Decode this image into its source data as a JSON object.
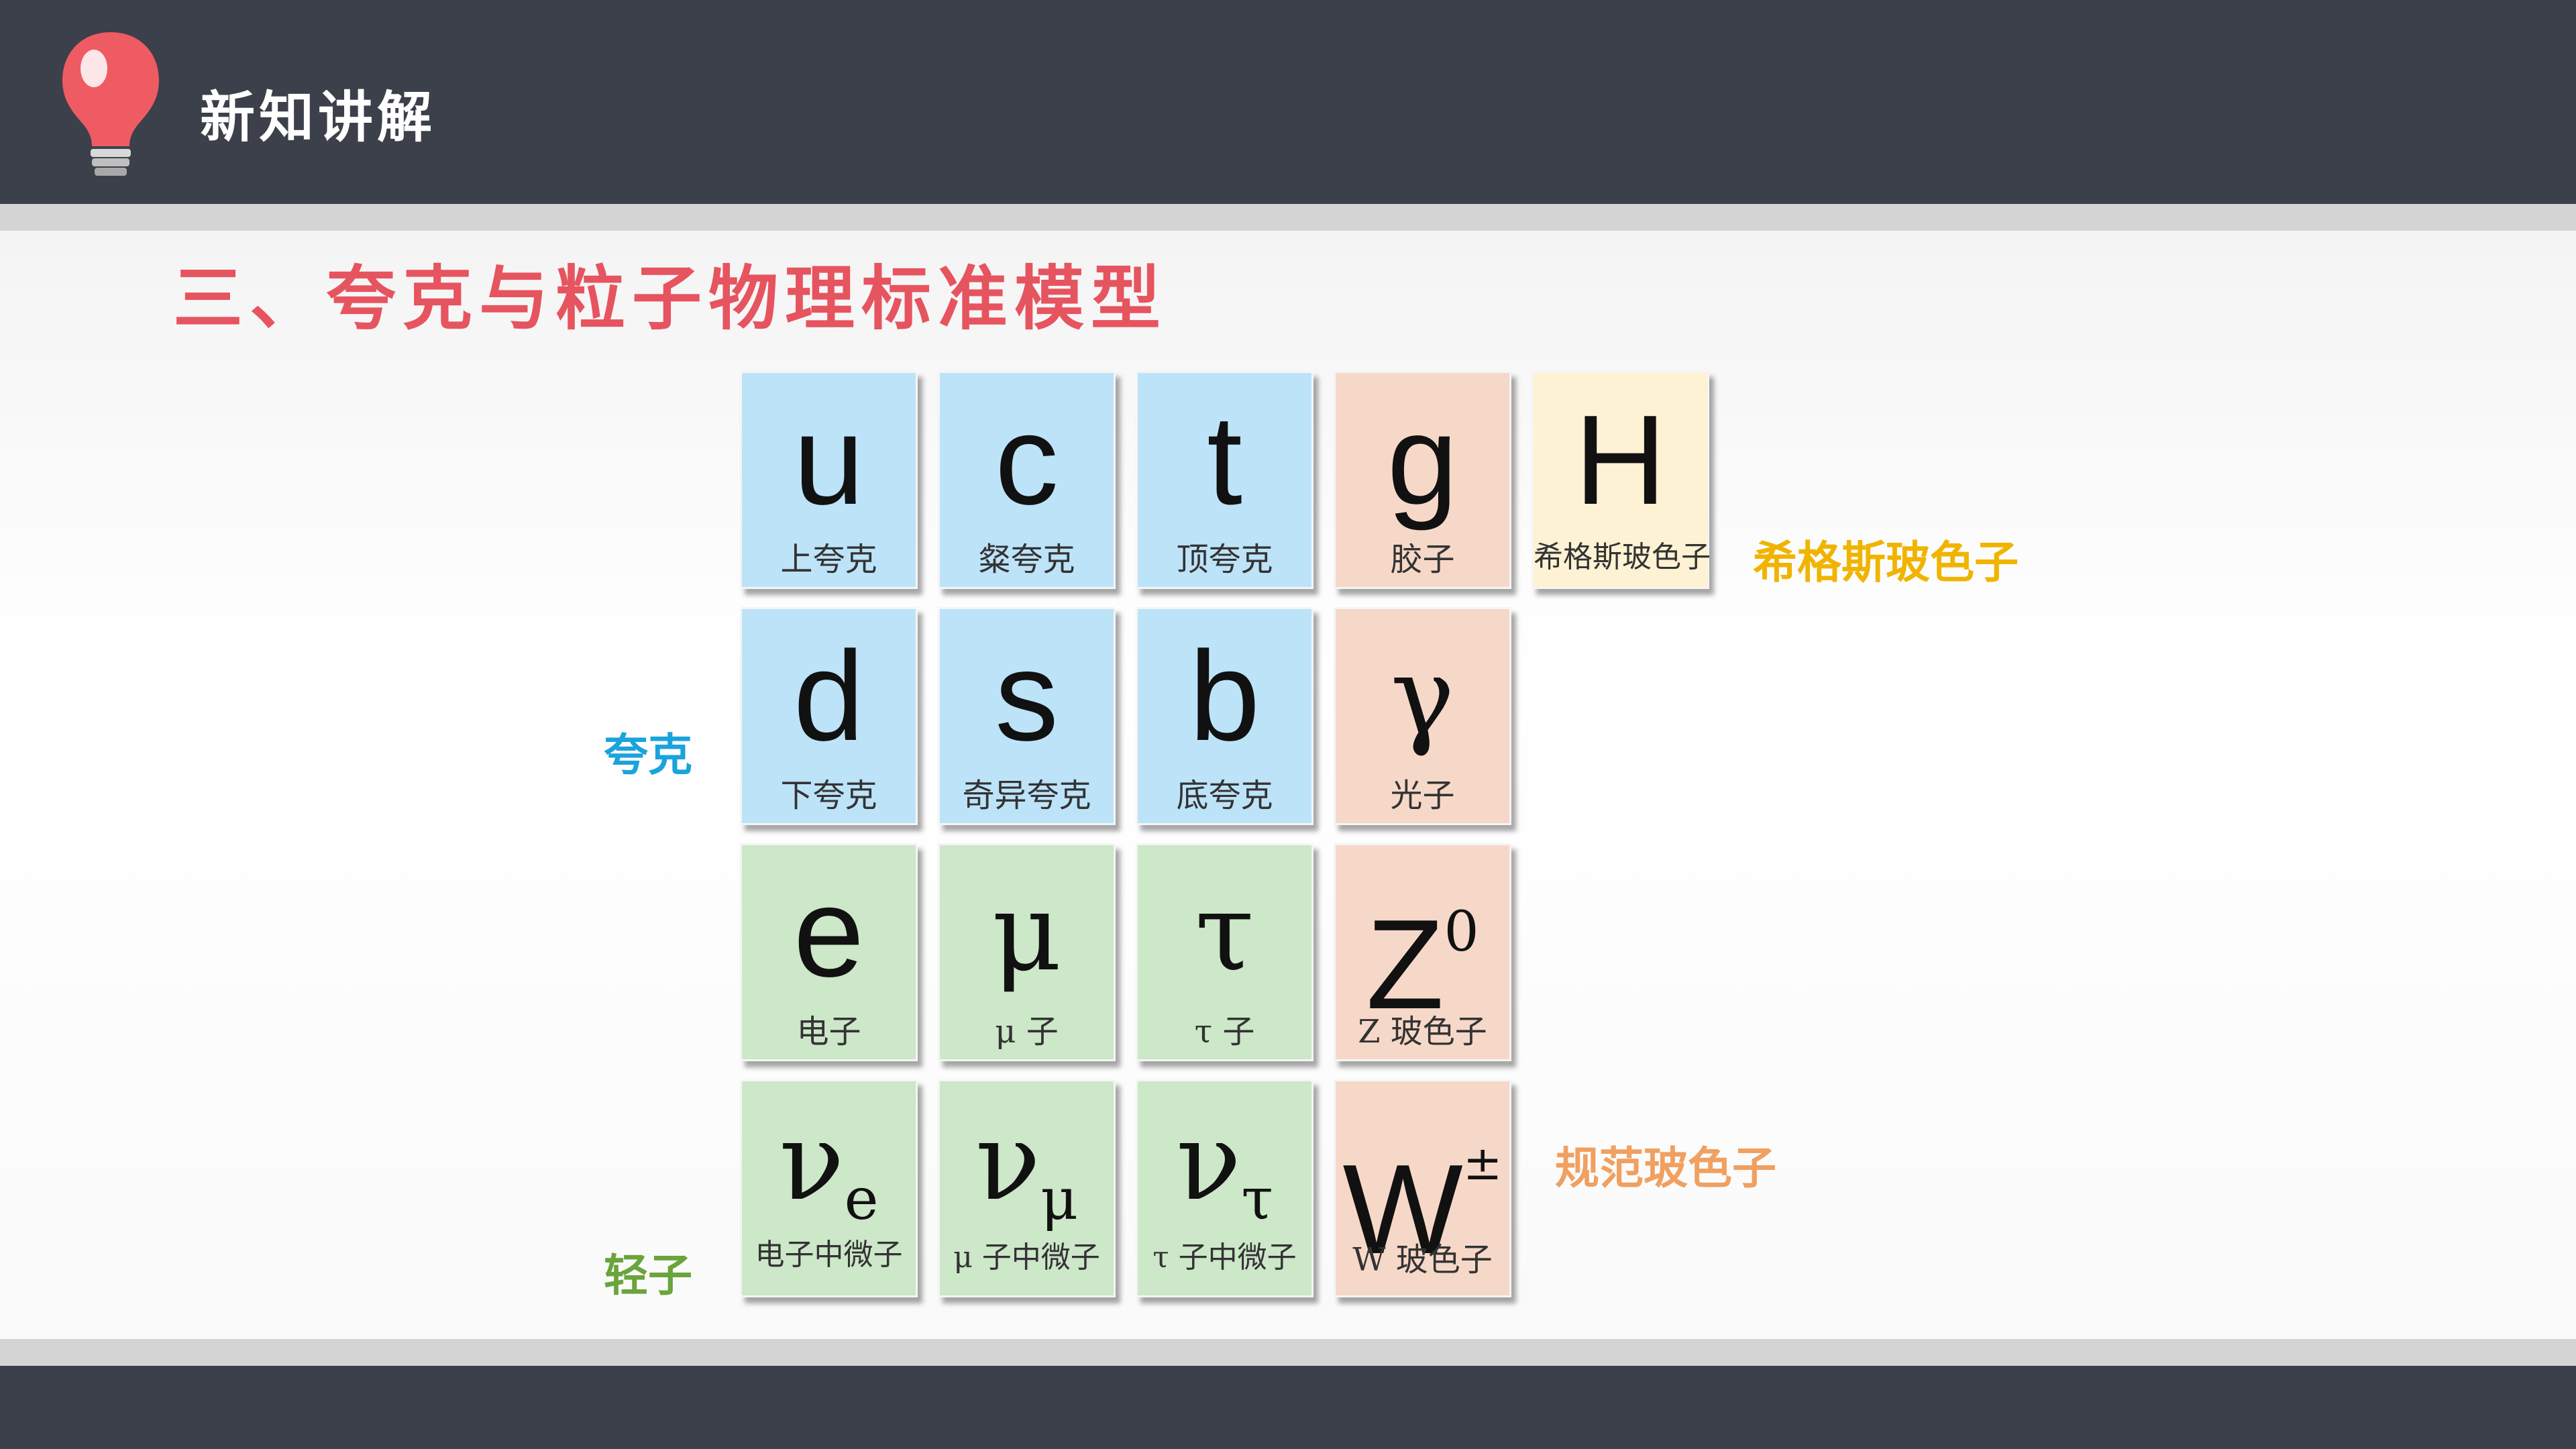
{
  "header": {
    "title": "新知讲解"
  },
  "section": {
    "title": "三、夸克与粒子物理标准模型"
  },
  "colors": {
    "bar": "#3b404a",
    "title_red": "#e6545f",
    "quark_tile": "#bde3f8",
    "lepton_tile": "#cde7c9",
    "gauge_tile": "#f6d8c9",
    "higgs_tile": "#fdf2d3",
    "label_quark": "#1aa3dc",
    "label_lepton": "#6aa43b",
    "label_higgs": "#f0b400",
    "label_gauge": "#f0a060"
  },
  "particles": {
    "u": {
      "symbol": "u",
      "name": "上夸克"
    },
    "c": {
      "symbol": "c",
      "name": "粲夸克"
    },
    "t": {
      "symbol": "t",
      "name": "顶夸克"
    },
    "g": {
      "symbol": "g",
      "name": "胶子"
    },
    "H": {
      "symbol": "H",
      "name": "希格斯玻色子"
    },
    "d": {
      "symbol": "d",
      "name": "下夸克"
    },
    "s": {
      "symbol": "s",
      "name": "奇异夸克"
    },
    "b": {
      "symbol": "b",
      "name": "底夸克"
    },
    "gamma": {
      "symbol": "γ",
      "name": "光子"
    },
    "e": {
      "symbol": "e",
      "name": "电子"
    },
    "mu": {
      "symbol": "μ",
      "name": "μ 子"
    },
    "tau": {
      "symbol": "τ",
      "name": "τ 子"
    },
    "Z": {
      "symbol": "Z",
      "sup": "0",
      "name": "Z 玻色子"
    },
    "nue": {
      "symbol": "ν",
      "sub": "e",
      "name": "电子中微子"
    },
    "numu": {
      "symbol": "ν",
      "sub": "μ",
      "name": "μ 子中微子"
    },
    "nutau": {
      "symbol": "ν",
      "sub": "τ",
      "name": "τ 子中微子"
    },
    "W": {
      "symbol": "W",
      "sup": "±",
      "name": "W 玻色子"
    }
  },
  "labels": {
    "quark": "夸克",
    "lepton": "轻子",
    "higgs": "希格斯玻色子",
    "gauge": "规范玻色子"
  }
}
